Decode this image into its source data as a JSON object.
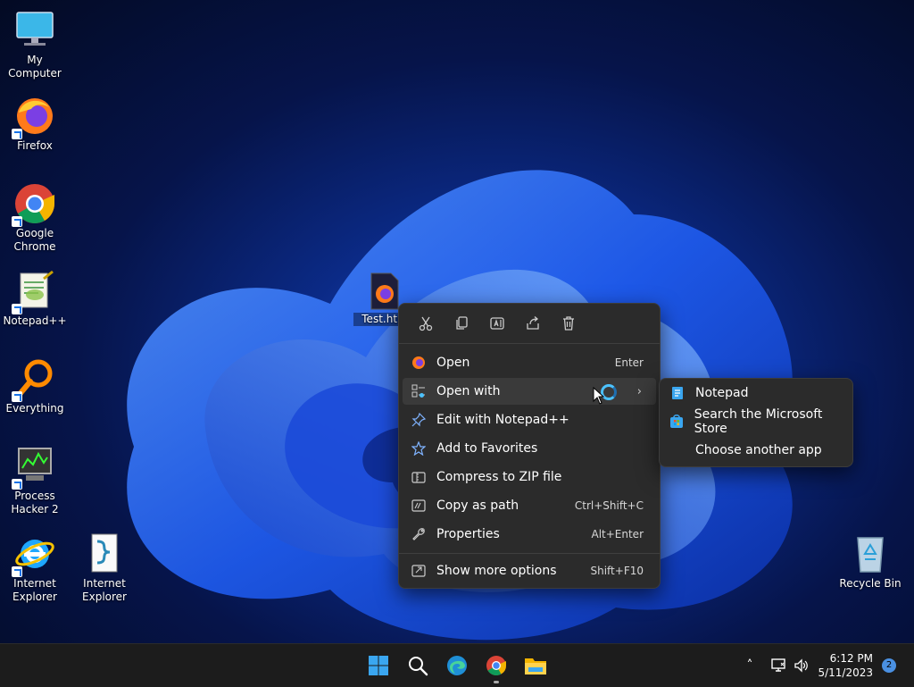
{
  "desktop": {
    "icons": [
      {
        "label": "My Computer",
        "icon": "monitor-icon"
      },
      {
        "label": "Firefox",
        "icon": "firefox-icon"
      },
      {
        "label": "Google Chrome",
        "icon": "chrome-icon"
      },
      {
        "label": "Notepad++",
        "icon": "notepad-plus-plus-icon"
      },
      {
        "label": "Everything",
        "icon": "search-loupe-icon"
      },
      {
        "label": "Process Hacker 2",
        "icon": "process-hacker-icon"
      },
      {
        "label": "Internet Explorer",
        "icon": "internet-explorer-icon"
      },
      {
        "label": "Internet Explorer",
        "icon": "script-file-icon"
      },
      {
        "label": "Recycle Bin",
        "icon": "recycle-bin-icon"
      },
      {
        "label": "Test.htm",
        "icon": "html-file-icon"
      }
    ]
  },
  "context_menu": {
    "toolbar": [
      "cut-icon",
      "copy-icon",
      "rename-icon",
      "share-icon",
      "delete-icon"
    ],
    "items": [
      {
        "label": "Open",
        "shortcut": "Enter"
      },
      {
        "label": "Open with",
        "shortcut": ""
      },
      {
        "label": "Edit with Notepad++",
        "shortcut": ""
      },
      {
        "label": "Add to Favorites",
        "shortcut": ""
      },
      {
        "label": "Compress to ZIP file",
        "shortcut": ""
      },
      {
        "label": "Copy as path",
        "shortcut": "Ctrl+Shift+C"
      },
      {
        "label": "Properties",
        "shortcut": "Alt+Enter"
      },
      {
        "label": "Show more options",
        "shortcut": "Shift+F10"
      }
    ]
  },
  "submenu": {
    "items": [
      {
        "label": "Notepad"
      },
      {
        "label": "Search the Microsoft Store"
      },
      {
        "label": "Choose another app"
      }
    ]
  },
  "taskbar": {
    "time": "6:12 PM",
    "date": "5/11/2023",
    "notifications": "2"
  },
  "colors": {
    "menu_bg": "#2b2b2b",
    "accent": "#4cc2ff",
    "taskbar_bg": "#1c1c1c"
  }
}
